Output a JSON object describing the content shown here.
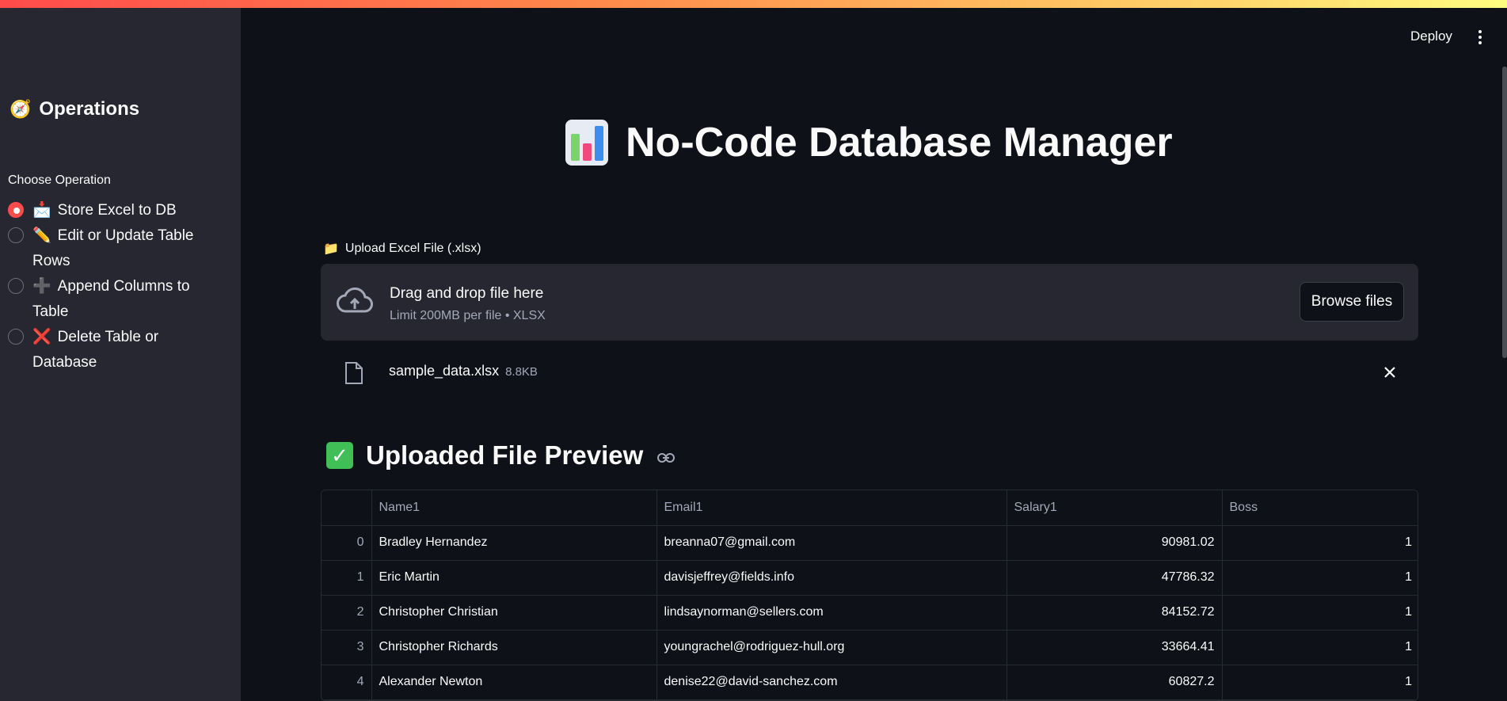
{
  "sidebar": {
    "title_emoji": "🧭",
    "title": "Operations",
    "choose_label": "Choose Operation",
    "options": [
      {
        "icon": "📩",
        "label": "Store Excel to DB",
        "selected": true
      },
      {
        "icon": "✏️",
        "label": "Edit or Update Table Rows",
        "selected": false
      },
      {
        "icon": "➕",
        "label": "Append Columns to Table",
        "selected": false
      },
      {
        "icon": "❌",
        "label": "Delete Table or Database",
        "selected": false
      }
    ]
  },
  "header": {
    "deploy_label": "Deploy"
  },
  "main": {
    "title": "No-Code Database Manager",
    "upload": {
      "label_icon": "📁",
      "label": "Upload Excel File (.xlsx)",
      "drag_text": "Drag and drop file here",
      "limit_text": "Limit 200MB per file • XLSX",
      "browse_label": "Browse files"
    },
    "file": {
      "name": "sample_data.xlsx",
      "size": "8.8KB"
    },
    "preview_check": "✓",
    "preview_title": "Uploaded File Preview",
    "table": {
      "columns": [
        "",
        "Name1",
        "Email1",
        "Salary1",
        "Boss"
      ],
      "rows": [
        [
          "0",
          "Bradley Hernandez",
          "breanna07@gmail.com",
          "90981.02",
          "1"
        ],
        [
          "1",
          "Eric Martin",
          "davisjeffrey@fields.info",
          "47786.32",
          "1"
        ],
        [
          "2",
          "Christopher Christian",
          "lindsaynorman@sellers.com",
          "84152.72",
          "1"
        ],
        [
          "3",
          "Christopher Richards",
          "youngrachel@rodriguez-hull.org",
          "33664.41",
          "1"
        ],
        [
          "4",
          "Alexander Newton",
          "denise22@david-sanchez.com",
          "60827.2",
          "1"
        ]
      ]
    }
  },
  "colors": {
    "accent": "#ff4b4b",
    "background": "#0e1117",
    "sidebar": "#262730"
  }
}
